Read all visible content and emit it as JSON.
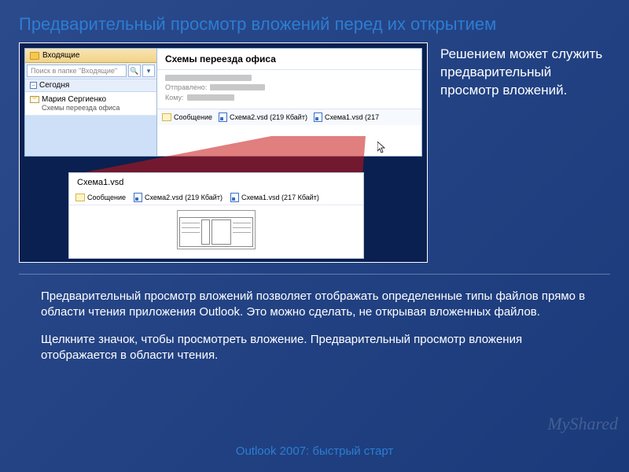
{
  "title": "Предварительный просмотр вложений перед их открытием",
  "side_text": "Решением может служить предварительный просмотр вложений.",
  "body_p1": "Предварительный просмотр вложений позволяет отображать определенные типы файлов прямо в области чтения приложения Outlook. Это можно сделать, не открывая вложенных файлов.",
  "body_p2": "Щелкните значок, чтобы просмотреть вложение. Предварительный просмотр вложения отображается в области чтения.",
  "footer": "Outlook 2007: быстрый старт",
  "watermark": "MyShared",
  "outlook": {
    "inbox_label": "Входящие",
    "search_placeholder": "Поиск в папке \"Входящие\"",
    "today_label": "Сегодня",
    "sender": "Мария Сергиенко",
    "msg_subject": "Схемы переезда офиса",
    "rp_title": "Схемы переезда офиса",
    "sent_label": "Отправлено:",
    "to_label": "Кому:",
    "attachments": {
      "message": "Сообщение",
      "a1": "Схема2.vsd (219 Кбайт)",
      "a2": "Схема1.vsd (217"
    }
  },
  "zoom": {
    "title": "Схема1.vsd",
    "att_message": "Сообщение",
    "att1": "Схема2.vsd (219 Кбайт)",
    "att2": "Схема1.vsd (217 Кбайт)"
  }
}
